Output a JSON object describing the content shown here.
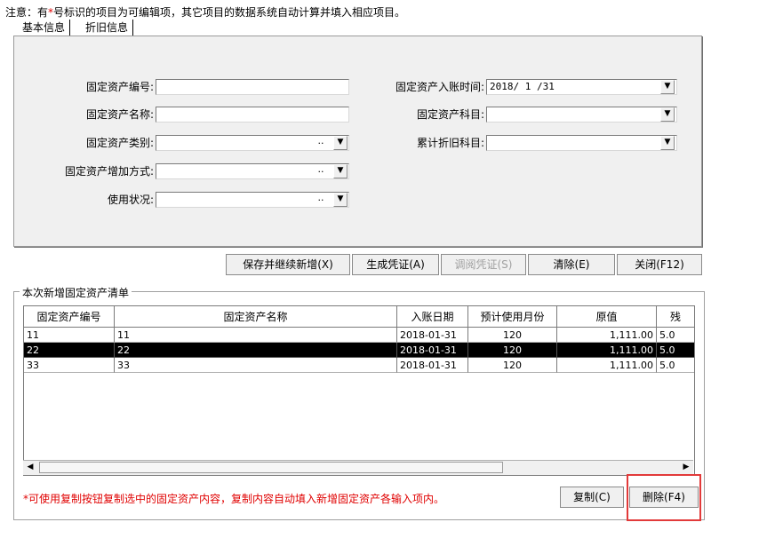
{
  "note": {
    "prefix": "注意：有",
    "star": "*",
    "suffix": "号标识的项目为可编辑项，其它项目的数据系统自动计算并填入相应项目。"
  },
  "tabs": [
    {
      "label": "基本信息"
    },
    {
      "label": "折旧信息"
    }
  ],
  "form": {
    "asset_code_label": "固定资产编号:",
    "asset_name_label": "固定资产名称:",
    "asset_category_label": "固定资产类别:",
    "asset_add_method_label": "固定资产增加方式:",
    "use_status_label": "使用状况:",
    "entry_date_label": "固定资产入账时间:",
    "entry_date_value": "2018/ 1 /31",
    "asset_subject_label": "固定资产科目:",
    "depr_subject_label": "累计折旧科目:"
  },
  "buttons": {
    "save_continue": "保存并继续新增(X)",
    "gen_voucher": "生成凭证(A)",
    "view_voucher": "调阅凭证(S)",
    "clear": "清除(E)",
    "close": "关闭(F12)",
    "copy": "复制(C)",
    "delete": "删除(F4)"
  },
  "group_title": "本次新增固定资产清单",
  "table": {
    "headers": [
      "固定资产编号",
      "固定资产名称",
      "入账日期",
      "预计使用月份",
      "原值",
      "残"
    ],
    "rows": [
      {
        "code": "11",
        "name": "11",
        "date": "2018-01-31",
        "months": "120",
        "value": "1,111.00",
        "res": "5.0"
      },
      {
        "code": "22",
        "name": "22",
        "date": "2018-01-31",
        "months": "120",
        "value": "1,111.00",
        "res": "5.0"
      },
      {
        "code": "33",
        "name": "33",
        "date": "2018-01-31",
        "months": "120",
        "value": "1,111.00",
        "res": "5.0"
      }
    ]
  },
  "hint": "*可使用复制按钮复制选中的固定资产内容，复制内容自动填入新增固定资产各输入项内。"
}
